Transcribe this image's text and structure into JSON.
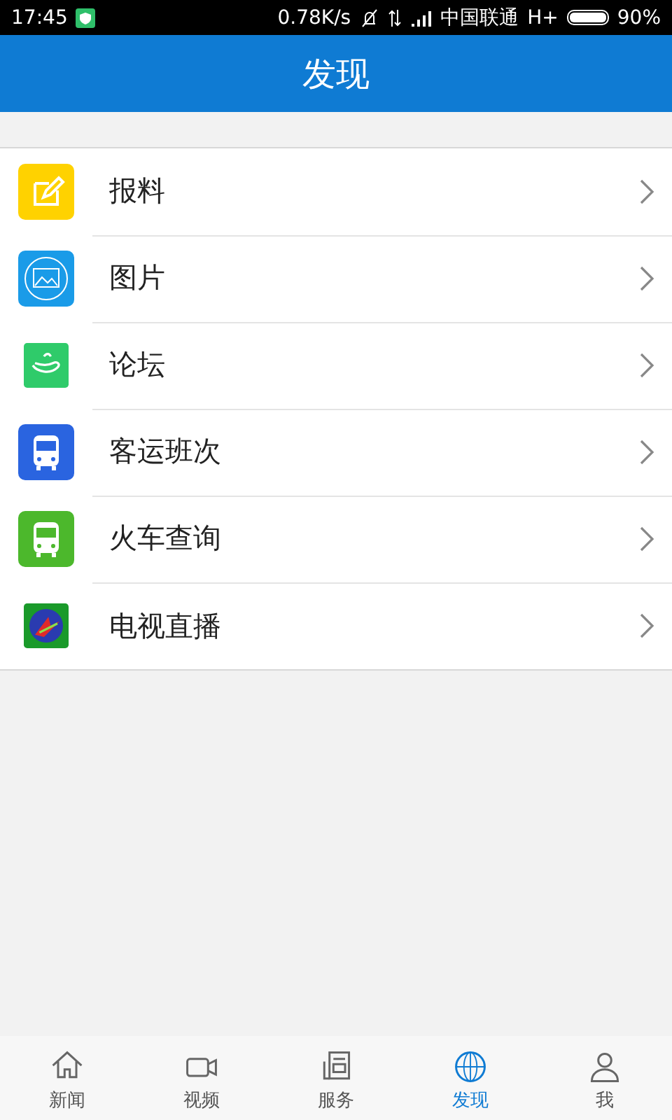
{
  "status_bar": {
    "time": "17:45",
    "speed": "0.78K/s",
    "carrier": "中国联通",
    "network": "H+",
    "battery": "90%"
  },
  "header": {
    "title": "发现"
  },
  "items": [
    {
      "kind": "edit",
      "label": "报料"
    },
    {
      "kind": "image",
      "label": "图片"
    },
    {
      "kind": "forum",
      "label": "论坛"
    },
    {
      "kind": "bus",
      "label": "客运班次"
    },
    {
      "kind": "train",
      "label": "火车查询"
    },
    {
      "kind": "tv",
      "label": "电视直播"
    }
  ],
  "tabs": [
    {
      "kind": "home",
      "label": "新闻",
      "selected": false
    },
    {
      "kind": "video",
      "label": "视频",
      "selected": false
    },
    {
      "kind": "service",
      "label": "服务",
      "selected": false
    },
    {
      "kind": "globe",
      "label": "发现",
      "selected": true
    },
    {
      "kind": "person",
      "label": "我",
      "selected": false
    }
  ]
}
